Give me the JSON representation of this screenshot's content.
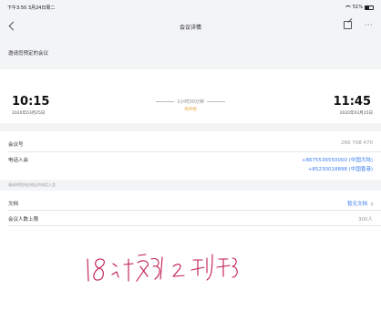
{
  "status_bar": {
    "time_date": "下午3:50  3月24日周二",
    "battery": "51%"
  },
  "nav": {
    "title": "会议详情"
  },
  "subheader": {
    "text": "邀请您预定的会议"
  },
  "schedule": {
    "start_time": "10:15",
    "start_date": "2020年03月25日",
    "duration": "1小时30分钟",
    "status": "待开始",
    "end_time": "11:45",
    "end_date": "2020年03月25日"
  },
  "details": {
    "meeting_id_label": "会议号",
    "meeting_id_value": "266 708 470",
    "phone_label": "电话入会",
    "phone_numbers": [
      "+8675536550000 (中国大陆)",
      "+85230018898 (中国香港)"
    ],
    "hint": "请选择您所在地区的电话入会",
    "doc_label": "文档",
    "doc_value": "暂无文档",
    "limit_label": "会议人数上限",
    "limit_value": "300人"
  },
  "handwriting": {
    "text": "18计算2班"
  },
  "colors": {
    "link": "#3a7ef3",
    "pending": "#e6a23c",
    "ink": "#c0184f"
  }
}
